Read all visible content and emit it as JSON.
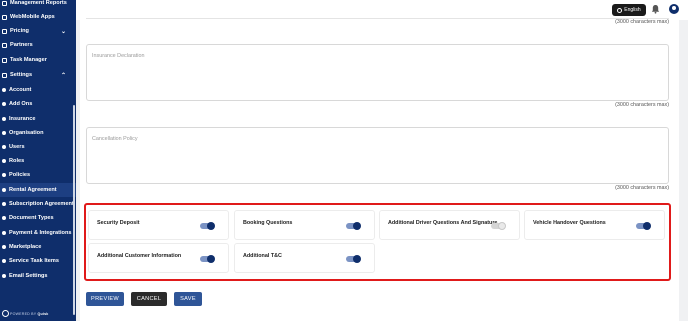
{
  "sidebar": {
    "items": [
      {
        "label": "Management Reports",
        "type": "icon",
        "chevron": ""
      },
      {
        "label": "WebMobile Apps",
        "type": "icon",
        "chevron": ""
      },
      {
        "label": "Pricing",
        "type": "icon",
        "chevron": "⌄"
      },
      {
        "label": "Partners",
        "type": "icon",
        "chevron": ""
      },
      {
        "label": "Task Manager",
        "type": "icon",
        "chevron": ""
      },
      {
        "label": "Settings",
        "type": "icon",
        "chevron": "⌃"
      },
      {
        "label": "Account",
        "type": "dot",
        "chevron": ""
      },
      {
        "label": "Add Ons",
        "type": "dot",
        "chevron": ""
      },
      {
        "label": "Insurance",
        "type": "dot",
        "chevron": ""
      },
      {
        "label": "Organisation",
        "type": "dot",
        "chevron": ""
      },
      {
        "label": "Users",
        "type": "dot",
        "chevron": ""
      },
      {
        "label": "Roles",
        "type": "dot",
        "chevron": ""
      },
      {
        "label": "Policies",
        "type": "dot",
        "chevron": ""
      },
      {
        "label": "Rental Agreement",
        "type": "dot",
        "chevron": "",
        "active": true
      },
      {
        "label": "Subscription Agreement",
        "type": "dot",
        "chevron": ""
      },
      {
        "label": "Document Types",
        "type": "dot",
        "chevron": ""
      },
      {
        "label": "Payment & Integrations",
        "type": "dot",
        "chevron": ""
      },
      {
        "label": "Marketplace",
        "type": "dot",
        "chevron": ""
      },
      {
        "label": "Service Task Items",
        "type": "dot",
        "chevron": ""
      },
      {
        "label": "Email Settings",
        "type": "dot",
        "chevron": ""
      }
    ],
    "powered_by": "POWERED BY",
    "powered_brand": "Quisk"
  },
  "topbar": {
    "language": "English"
  },
  "form": {
    "char_max_top": "(3000 characters max)",
    "insurance_placeholder": "Insurance Declaration",
    "insurance_char_max": "(3000 characters max)",
    "cancellation_placeholder": "Cancellation Policy",
    "cancellation_char_max": "(3000 characters max)"
  },
  "toggles": [
    {
      "label": "Security Deposit",
      "on": true
    },
    {
      "label": "Booking Questions",
      "on": true
    },
    {
      "label": "Additional Driver Questions And Signature",
      "on": false
    },
    {
      "label": "Vehicle Handover Questions",
      "on": true
    },
    {
      "label": "Additional Customer Information",
      "on": true
    },
    {
      "label": "Additional T&C",
      "on": true
    }
  ],
  "actions": {
    "preview": "PREVIEW",
    "cancel": "CANCEL",
    "save": "SAVE"
  }
}
